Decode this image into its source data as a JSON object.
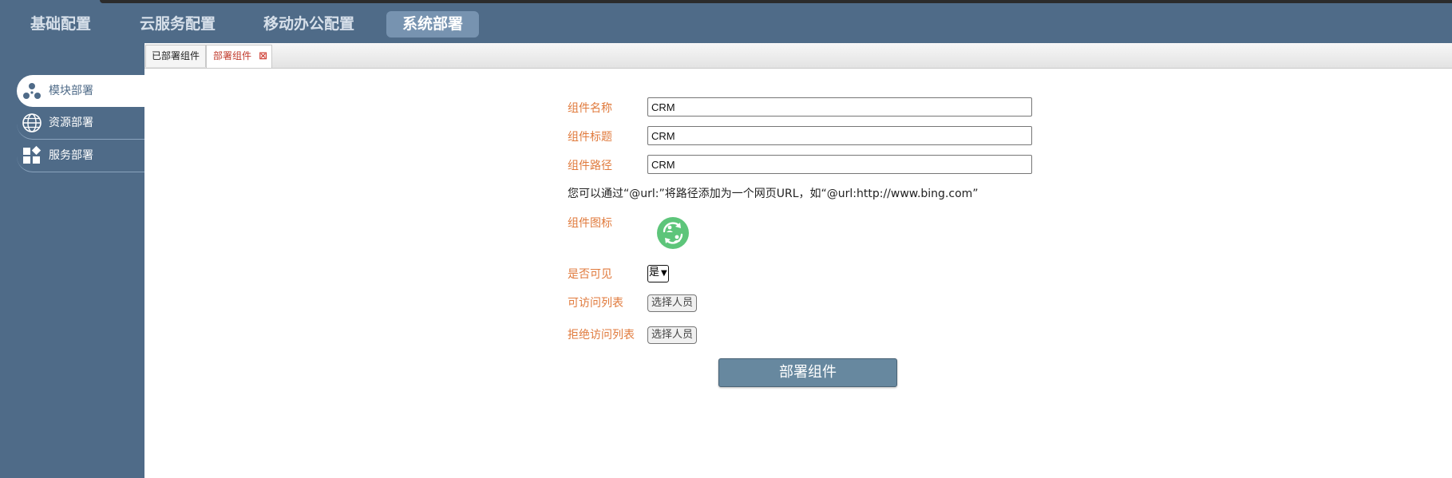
{
  "topnav": [
    {
      "label": "基础配置"
    },
    {
      "label": "云服务配置"
    },
    {
      "label": "移动办公配置"
    },
    {
      "label": "系统部署",
      "active": true
    }
  ],
  "sidebar": [
    {
      "label": "模块部署",
      "icon": "module-icon",
      "active": true
    },
    {
      "label": "资源部署",
      "icon": "globe-icon"
    },
    {
      "label": "服务部署",
      "icon": "widgets-icon"
    }
  ],
  "tabs": {
    "deployed": "已部署组件",
    "deploy": "部署组件"
  },
  "form": {
    "name_label": "组件名称",
    "name_value": "CRM",
    "title_label": "组件标题",
    "title_value": "CRM",
    "path_label": "组件路径",
    "path_value": "CRM",
    "hint": "您可以通过“@url:”将路径添加为一个网页URL，如“@url:http://www.bing.com”",
    "icon_label": "组件图标",
    "icon_name": "crm-sync-icon",
    "visible_label": "是否可见",
    "visible_value": "是",
    "allow_label": "可访问列表",
    "allow_button": "选择人员",
    "deny_label": "拒绝访问列表",
    "deny_button": "选择人员",
    "submit": "部署组件"
  },
  "colors": {
    "nav_bg": "#4f6b88",
    "label": "#e07a3c",
    "button": "#67889f",
    "icon_green": "#5dc57a"
  }
}
